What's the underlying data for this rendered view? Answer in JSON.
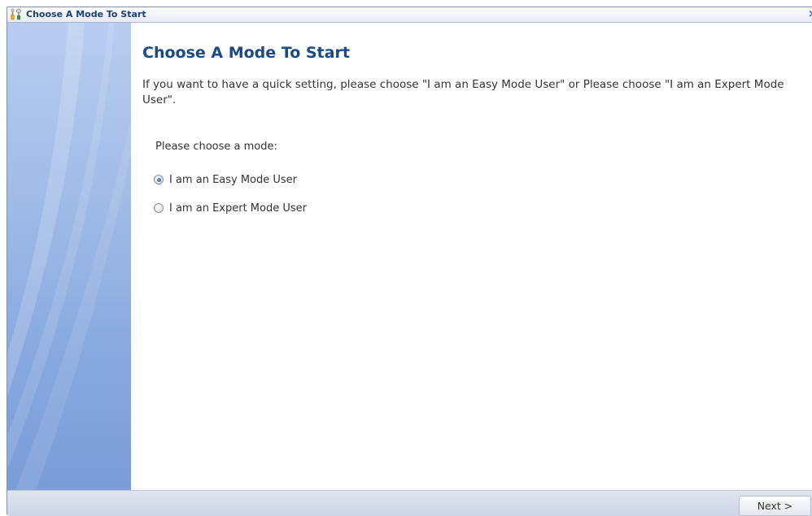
{
  "window": {
    "title": "Choose A Mode To Start",
    "close_glyph": "×"
  },
  "main": {
    "heading": "Choose A Mode To Start",
    "intro": "If you want to have a quick setting, please choose \"I am an Easy Mode User\" or Please choose \"I am an Expert Mode User\".",
    "prompt": "Please choose a mode:",
    "modes": [
      {
        "label": "I am an Easy Mode User",
        "selected": true
      },
      {
        "label": "I am an Expert Mode User",
        "selected": false
      }
    ]
  },
  "footer": {
    "next_label": "Next >"
  },
  "colors": {
    "title_text": "#1a3f7a",
    "heading": "#1a4a85",
    "sidebar": "#9ebae6"
  },
  "icons": {
    "title_icon": "tools-icon",
    "close": "close-icon"
  }
}
